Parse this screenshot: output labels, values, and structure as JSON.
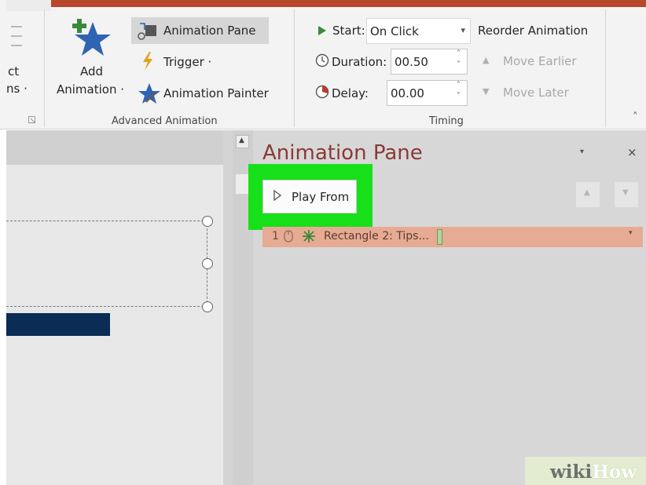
{
  "ribbon": {
    "left_partial": {
      "line1": "ct",
      "line2": "ns ·"
    },
    "add_animation": {
      "line1": "Add",
      "line2": "Animation ·"
    },
    "animation_pane_label": "Animation Pane",
    "trigger_label": "Trigger ·",
    "animation_painter_label": "Animation Painter",
    "group_advanced_label": "Advanced Animation",
    "start_label": "Start:",
    "start_value": "On Click",
    "duration_label": "Duration:",
    "duration_value": "00.50",
    "delay_label": "Delay:",
    "delay_value": "00.00",
    "group_timing_label": "Timing",
    "reorder_label": "Reorder Animation",
    "move_earlier_label": "Move Earlier",
    "move_later_label": "Move Later"
  },
  "pane": {
    "title": "Animation Pane",
    "play_from_label": "Play From",
    "items": [
      {
        "index": "1",
        "label": "Rectangle 2: Tips..."
      }
    ]
  },
  "watermark": {
    "part1": "wiki",
    "part2": "How"
  },
  "colors": {
    "highlight": "#17e01a",
    "pane_title": "#8a3a37",
    "item_bg": "#e7aa93",
    "ribbon_accent": "#b7472a"
  }
}
